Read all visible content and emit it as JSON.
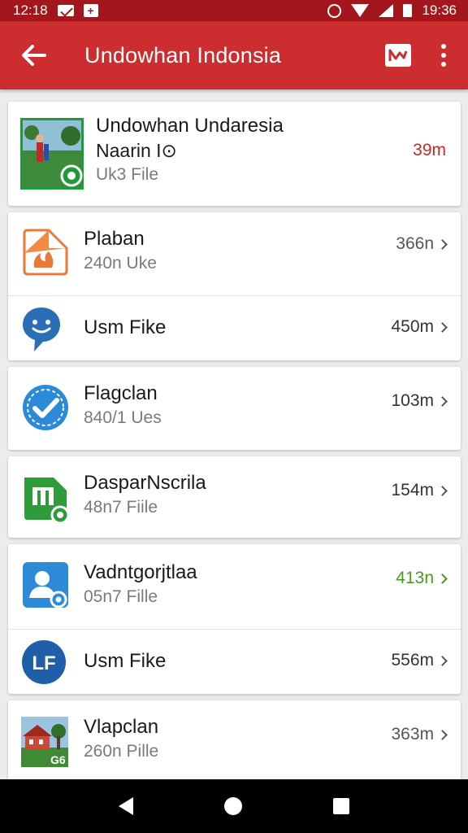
{
  "status_bar": {
    "time_left": "12:18",
    "time_right": "19:36"
  },
  "app_bar": {
    "title": "Undowhan Indonsia"
  },
  "items": [
    {
      "title": "Undowhan Undaresia",
      "subtitle": "Naarin I⊙",
      "detail": "Uk3 File",
      "size": "39m",
      "size_color": "#c62828",
      "icon": "photo-thumbnail-icon",
      "chevron": false
    },
    {
      "title": "Plaban",
      "subtitle": "240n Uke",
      "size": "366n",
      "size_color": "#555555",
      "icon": "flame-doc-icon",
      "chevron": true
    },
    {
      "title": "Usm Fike",
      "size": "450m",
      "size_color": "#333333",
      "icon": "chat-bubble-icon",
      "chevron": true
    },
    {
      "title": "Flagclan",
      "subtitle": "840/1 Ues",
      "size": "103m",
      "size_color": "#333333",
      "icon": "verified-check-icon",
      "chevron": true
    },
    {
      "title": "DasparNscrila",
      "subtitle": "48n7 Fiile",
      "size": "154m",
      "size_color": "#333333",
      "icon": "green-file-icon",
      "chevron": true
    },
    {
      "title": "Vadntgorjtlaa",
      "subtitle": "05n7 Fille",
      "size": "413n",
      "size_color": "#4a9a1e",
      "icon": "contact-icon",
      "chevron": true
    },
    {
      "title": "Usm Fike",
      "size": "556m",
      "size_color": "#333333",
      "icon": "lf-badge-icon",
      "chevron": true
    },
    {
      "title": "Vlapclan",
      "subtitle": "260n Pille",
      "size": "363m",
      "size_color": "#555555",
      "icon": "house-photo-icon",
      "chevron": true
    }
  ]
}
